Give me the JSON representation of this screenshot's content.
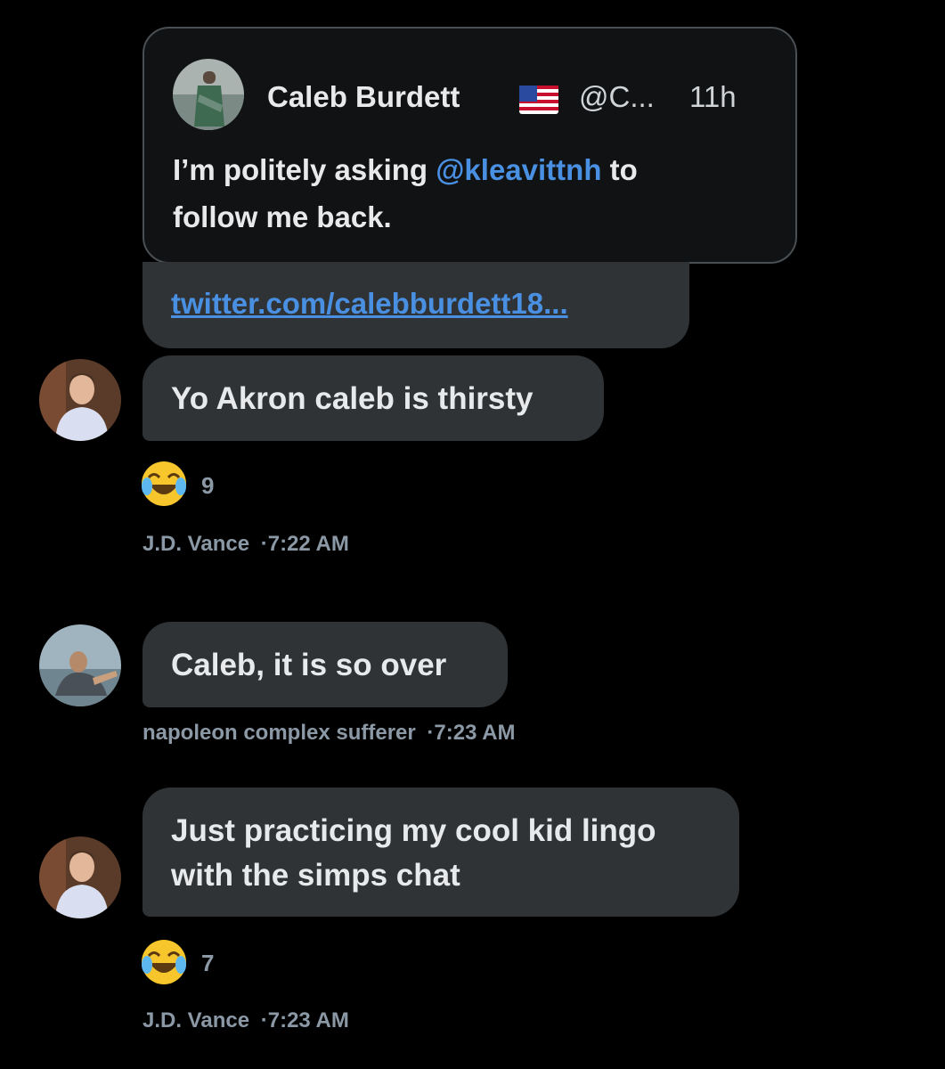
{
  "quoted_tweet": {
    "author_name": "Caleb Burdett",
    "flag_icon": "us-flag-icon",
    "handle": "@C...",
    "time": "11h",
    "text_before": "I’m politely asking ",
    "mention": "@kleavittnh",
    "text_after_line1": " to",
    "text_line2": "follow me back."
  },
  "link_message": {
    "url": "twitter.com/calebburdett18..."
  },
  "messages": [
    {
      "text": "Yo Akron caleb is thirsty",
      "reaction_count": "9",
      "sender": "J.D. Vance",
      "time": "·7:22 AM"
    },
    {
      "text": "Caleb, it is so over",
      "sender": "napoleon complex sufferer",
      "time": "·7:23 AM"
    },
    {
      "text_line1": "Just practicing my cool kid lingo",
      "text_line2": "with the simps chat",
      "reaction_count": "7",
      "sender": "J.D. Vance",
      "time": "·7:23 AM"
    }
  ],
  "colors": {
    "background": "#000000",
    "bubble": "#2f3336",
    "link": "#4a90e2",
    "meta": "#8b98a5"
  }
}
